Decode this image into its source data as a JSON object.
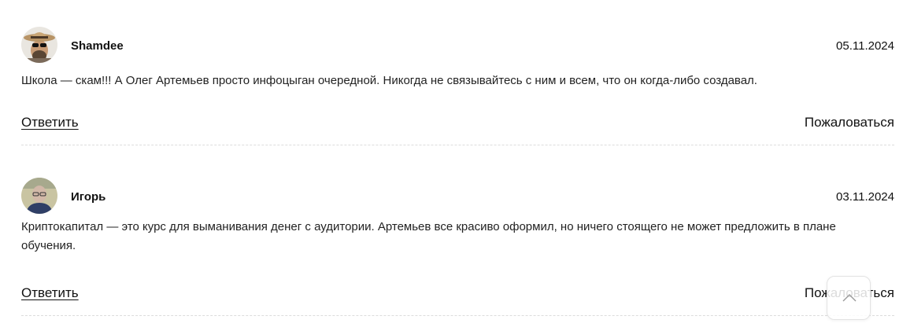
{
  "comments": [
    {
      "author": "Shamdee",
      "date": "05.11.2024",
      "text": "Школа — скам!!! А Олег Артемьев просто инфоцыган очередной. Никогда не связывайтесь с ним и всем, что он когда-либо создавал.",
      "reply_label": "Ответить",
      "report_label": "Пожаловаться"
    },
    {
      "author": "Игорь",
      "date": "03.11.2024",
      "text": "Криптокапитал — это курс для выманивания денег с аудитории. Артемьев все красиво оформил, но ничего стоящего не может предложить в плане обучения.",
      "reply_label": "Ответить",
      "report_label": "Пожаловаться"
    }
  ],
  "scroll_top": {
    "icon": "chevron-up-icon"
  },
  "colors": {
    "text": "#1a1a1a",
    "divider": "#dcdcdc",
    "background": "#ffffff"
  }
}
